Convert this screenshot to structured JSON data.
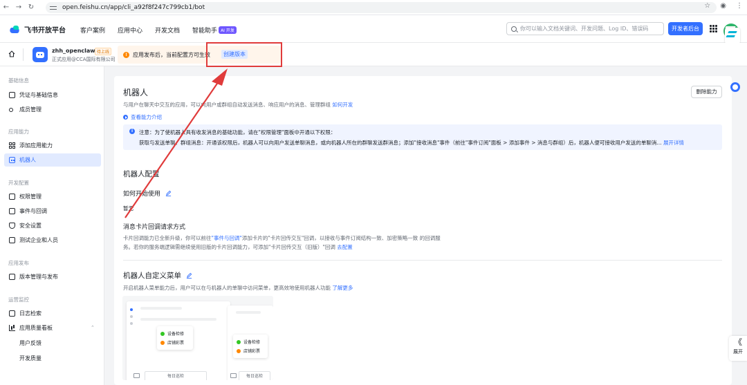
{
  "browser": {
    "url": "open.feishu.cn/app/cli_a92f8f247c799cb1/bot"
  },
  "header": {
    "brand": "飞书开放平台",
    "nav": [
      "客户案例",
      "应用中心",
      "开发文档",
      "智能助手"
    ],
    "ai_badge": "AI 开发",
    "search_placeholder": "你可以输入文档关键词、开发问题、Log ID、错误码",
    "dev_console": "开发者后台"
  },
  "app": {
    "name": "zhh_openclawbot",
    "status": "待上线",
    "subtitle": "正式应用@CCA国际有限公司",
    "notice": "应用发布后，当前配置方可生效",
    "create_version": "创建版本"
  },
  "sidebar": {
    "sections": [
      {
        "title": "基础信息",
        "items": [
          "凭证与基础信息",
          "成员管理"
        ]
      },
      {
        "title": "应用能力",
        "items": [
          "添加应用能力",
          "机器人"
        ]
      },
      {
        "title": "开发配置",
        "items": [
          "权限管理",
          "事件与回调",
          "安全设置",
          "测试企业和人员"
        ]
      },
      {
        "title": "应用发布",
        "items": [
          "版本管理与发布"
        ]
      },
      {
        "title": "运营监控",
        "items": [
          "日志检索",
          "应用质量看板"
        ]
      }
    ],
    "sub_items": [
      "用户反馈",
      "开发质量"
    ]
  },
  "main": {
    "title": "机器人",
    "remove_button": "删除能力",
    "desc": "与用户在聊天中交互的应用，可以向用户或群组自动发送消息、响应用户的消息、管理群组",
    "how_to_dev": "如何开发",
    "intro_link": "查看能力介绍",
    "notice_line1": "注意：为了使机器人具有收发消息的基础功能，请在\"权限管理\"面板中开通以下权限：",
    "notice_line2": "获取与发送单聊、群组消息：开通该权限后，机器人可以向用户发送单聊消息，或向机器人所在的群聊发送群消息；添加\"接收消息\"事件（前往\"事件订阅\"面板 > 添加事件 > 消息与群组）后，机器人便可接收用户发送的单聊消...",
    "expand_detail": "展开详情",
    "config_title": "机器人配置",
    "how_to_start": "如何开始使用",
    "none": "暂无",
    "card_callback_title": "消息卡片回调请求方式",
    "card_callback_p1_a": "卡片回调能力已全新升级，你可以前往",
    "card_callback_link": "\"事件与回调\"",
    "card_callback_p1_b": "添加卡片的\"卡片回传交互\"回调，以接收与事件订阅结构一致、加密策略一致",
    "card_callback_p2": "的回调服务。若你的服务端逻辑需继续使用旧版的卡片回调能力，可添加\"卡片回传交互（旧版）\"回调",
    "go_config": "去配置",
    "menu_title": "机器人自定义菜单",
    "menu_desc": "开启机器人菜单能力后，用户可以在与机器人的单聊中访问菜单，更高效地使用机器人功能",
    "learn_more": "了解更多",
    "preview": {
      "menu_items": [
        "设备检修",
        "店铺彩票"
      ],
      "input_label": "每日巡检"
    }
  },
  "right_rail": {
    "expand_glyph": "《",
    "expand_label": "展开"
  },
  "colors": {
    "primary": "#3370ff",
    "annotation": "#e03b3b",
    "warning": "#ff8800"
  }
}
